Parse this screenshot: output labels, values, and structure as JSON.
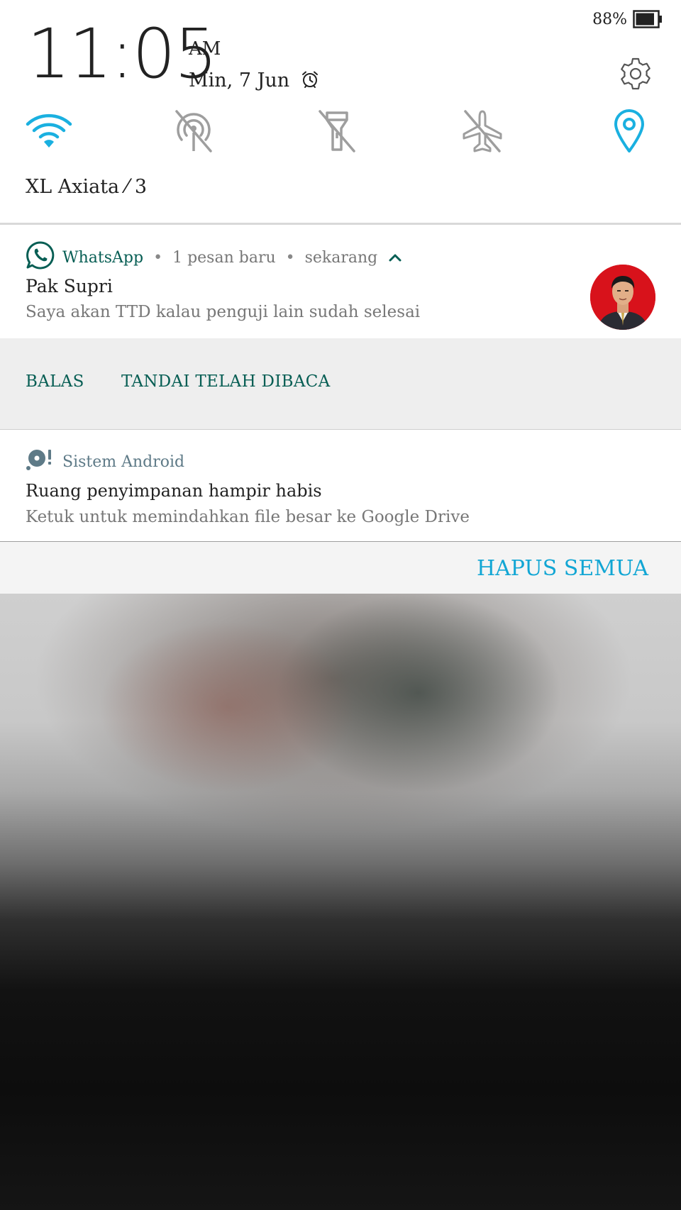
{
  "status": {
    "battery_percent": "88%",
    "battery_level": 0.88
  },
  "header": {
    "time": "11:05",
    "ampm": "AM",
    "date": "Min, 7 Jun"
  },
  "quick_toggles": [
    {
      "name": "wifi",
      "icon": "wifi-icon",
      "state": "on"
    },
    {
      "name": "hotspot",
      "icon": "hotspot-off-icon",
      "state": "off"
    },
    {
      "name": "flashlight",
      "icon": "flashlight-off-icon",
      "state": "off"
    },
    {
      "name": "airplane",
      "icon": "airplane-off-icon",
      "state": "off"
    },
    {
      "name": "location",
      "icon": "location-icon",
      "state": "on"
    }
  ],
  "carrier": "XL Axiata ⁄ 3",
  "notifications": {
    "whatsapp": {
      "app": "WhatsApp",
      "summary": "1 pesan baru",
      "time": "sekarang",
      "title": "Pak Supri",
      "text": "Saya akan TTD kalau penguji lain sudah selesai",
      "actions": {
        "reply": "BALAS",
        "mark_read": "TANDAI TELAH DIBACA"
      }
    },
    "system": {
      "app": "Sistem Android",
      "title": "Ruang penyimpanan hampir habis",
      "text": "Ketuk untuk memindahkan file besar ke Google Drive"
    }
  },
  "clear_all": "HAPUS SEMUA",
  "colors": {
    "accent": "#12a6d4",
    "whatsapp": "#075e54",
    "toggle_on": "#1ab0e0",
    "toggle_off": "#9e9e9e"
  }
}
